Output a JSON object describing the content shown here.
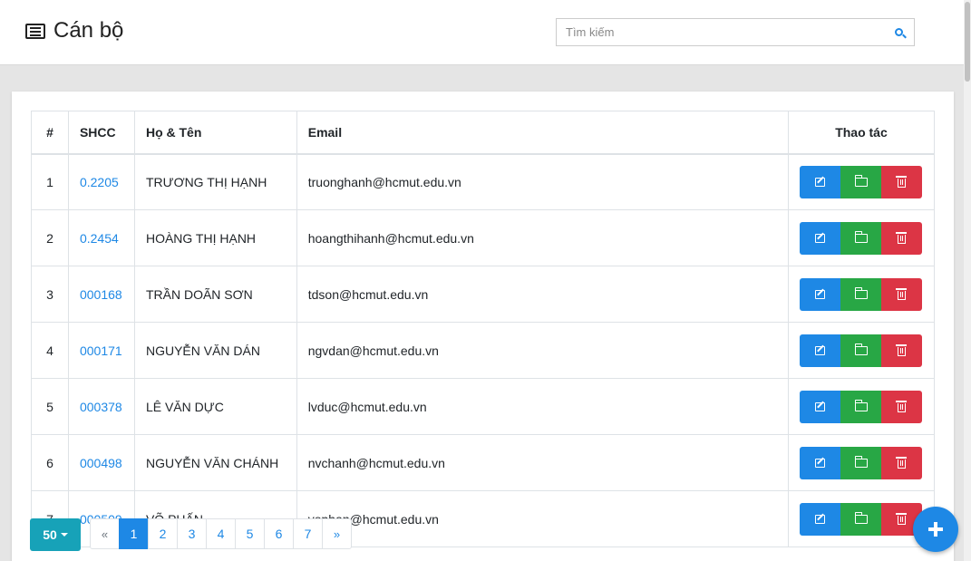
{
  "header": {
    "title": "Cán bộ",
    "search_placeholder": "Tìm kiếm"
  },
  "table": {
    "columns": [
      "#",
      "SHCC",
      "Họ & Tên",
      "Email",
      "Thao tác"
    ],
    "rows": [
      {
        "num": "1",
        "shcc": "0.2205",
        "name": "TRƯƠNG THỊ HẠNH",
        "email": "truonghanh@hcmut.edu.vn"
      },
      {
        "num": "2",
        "shcc": "0.2454",
        "name": "HOÀNG THỊ HẠNH",
        "email": "hoangthihanh@hcmut.edu.vn"
      },
      {
        "num": "3",
        "shcc": "000168",
        "name": "TRẦN DOÃN SƠN",
        "email": "tdson@hcmut.edu.vn"
      },
      {
        "num": "4",
        "shcc": "000171",
        "name": "NGUYỄN VĂN DÁN",
        "email": "ngvdan@hcmut.edu.vn"
      },
      {
        "num": "5",
        "shcc": "000378",
        "name": "LÊ VĂN DỰC",
        "email": "lvduc@hcmut.edu.vn"
      },
      {
        "num": "6",
        "shcc": "000498",
        "name": "NGUYỄN VĂN CHÁNH",
        "email": "nvchanh@hcmut.edu.vn"
      },
      {
        "num": "7",
        "shcc": "000509",
        "name": "VÕ PHẤN",
        "email": "vophan@hcmut.edu.vn"
      }
    ]
  },
  "pagination": {
    "page_size": "50",
    "prev": "«",
    "next": "»",
    "pages": [
      "1",
      "2",
      "3",
      "4",
      "5",
      "6",
      "7"
    ],
    "active_page": "1"
  },
  "colors": {
    "primary": "#1e88e5",
    "success": "#28a745",
    "danger": "#dc3545",
    "info": "#17a2b8"
  },
  "icons": {
    "title": "list-alt-icon",
    "search": "search-icon",
    "edit": "edit-icon",
    "open": "folder-open-icon",
    "delete": "trash-icon",
    "fab": "plus-icon"
  }
}
